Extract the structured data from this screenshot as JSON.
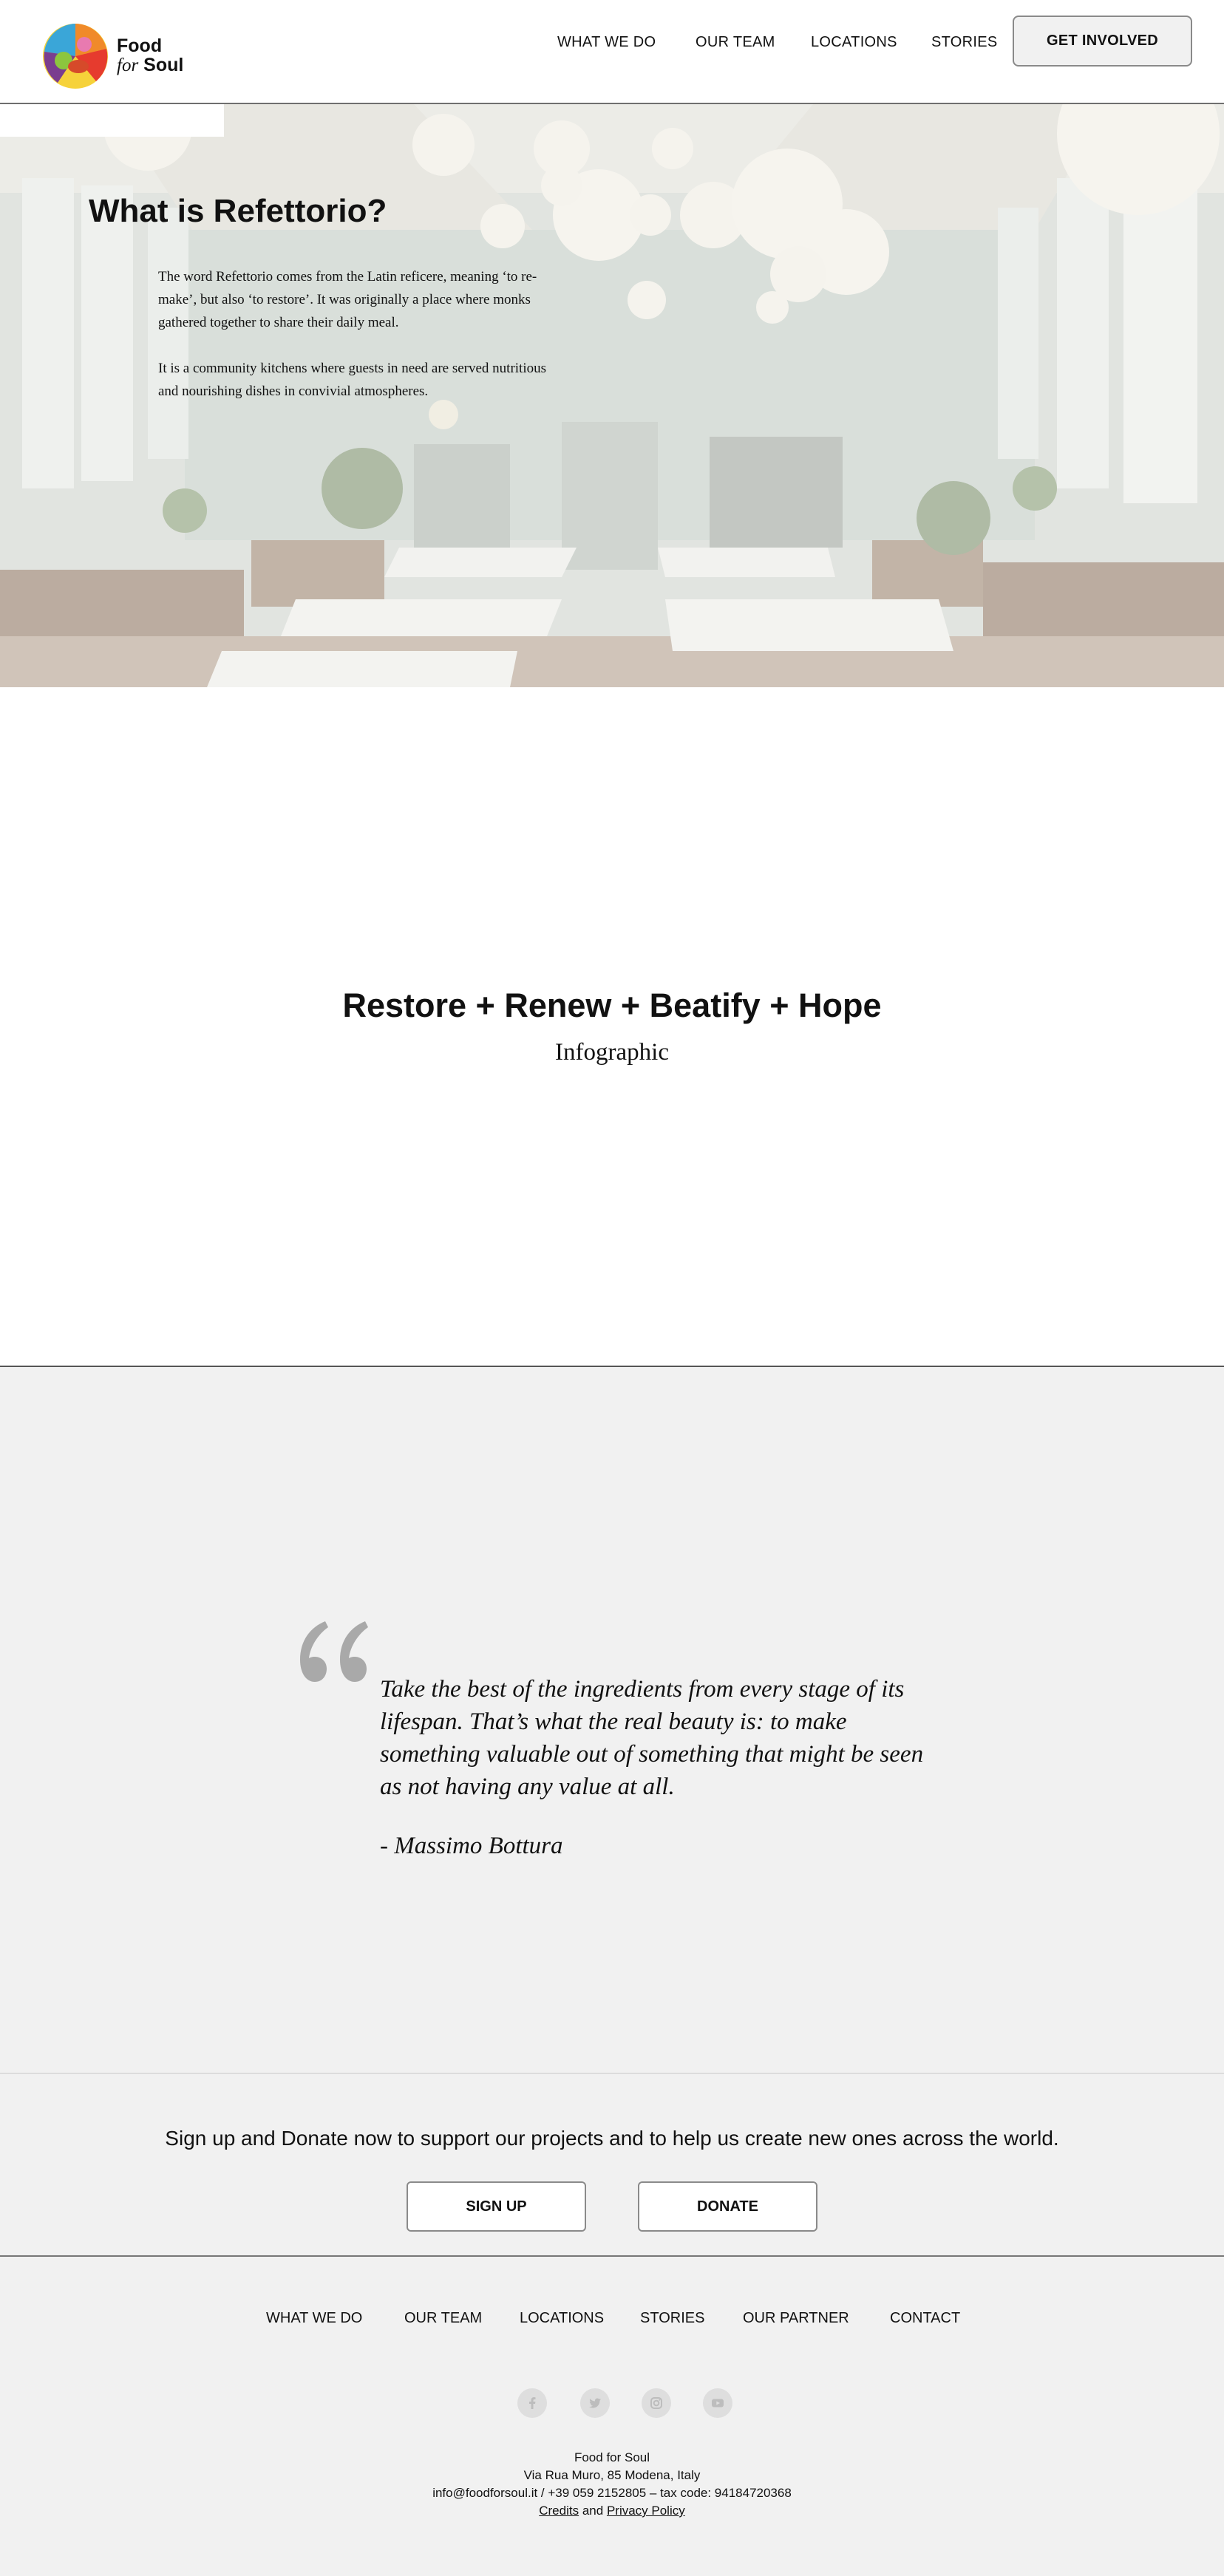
{
  "header": {
    "logo": {
      "line1": "Food",
      "for": "for",
      "soul": "Soul"
    },
    "nav": [
      "WHAT WE DO",
      "OUR TEAM",
      "LOCATIONS",
      "STORIES"
    ],
    "cta_label": "GET INVOLVED"
  },
  "hero": {
    "title": "What is Refettorio?",
    "p1": "The word Refettorio comes from the Latin reficere, meaning ‘to re-make’, but also ‘to restore’. It was originally a place where monks gathered together to share their daily meal.",
    "p2": "It is a community kitchens where guests in need are served nutritious and nourishing dishes in convivial atmospheres."
  },
  "infographic": {
    "title": "Restore + Renew + Beatify + Hope",
    "subtitle": "Infographic"
  },
  "quote": {
    "text": "Take the best of the ingredients from every stage of its lifespan. That’s what the real beauty is: to make something valuable out of something that might be seen as not having any value at all.",
    "author": "- Massimo Bottura"
  },
  "cta": {
    "text": "Sign up and Donate now to support our projects and to help us create new ones across the world.",
    "signup_label": "SIGN UP",
    "donate_label": "DONATE"
  },
  "footer": {
    "nav": [
      "WHAT WE DO",
      "OUR TEAM",
      "LOCATIONS",
      "STORIES",
      "OUR PARTNER",
      "CONTACT"
    ],
    "social_icons": [
      "facebook-icon",
      "twitter-icon",
      "instagram-icon",
      "youtube-icon"
    ],
    "org": "Food for Soul",
    "address": "Via Rua Muro, 85 Modena, Italy",
    "contact": "info@foodforsoul.it / +39 059 2152805 – tax code: 94184720368",
    "credits": "Credits",
    "and": "and",
    "privacy": "Privacy Policy"
  },
  "colors": {
    "background_light": "#f1f1f1",
    "text": "#111111",
    "button_border": "#8a8a8a"
  }
}
